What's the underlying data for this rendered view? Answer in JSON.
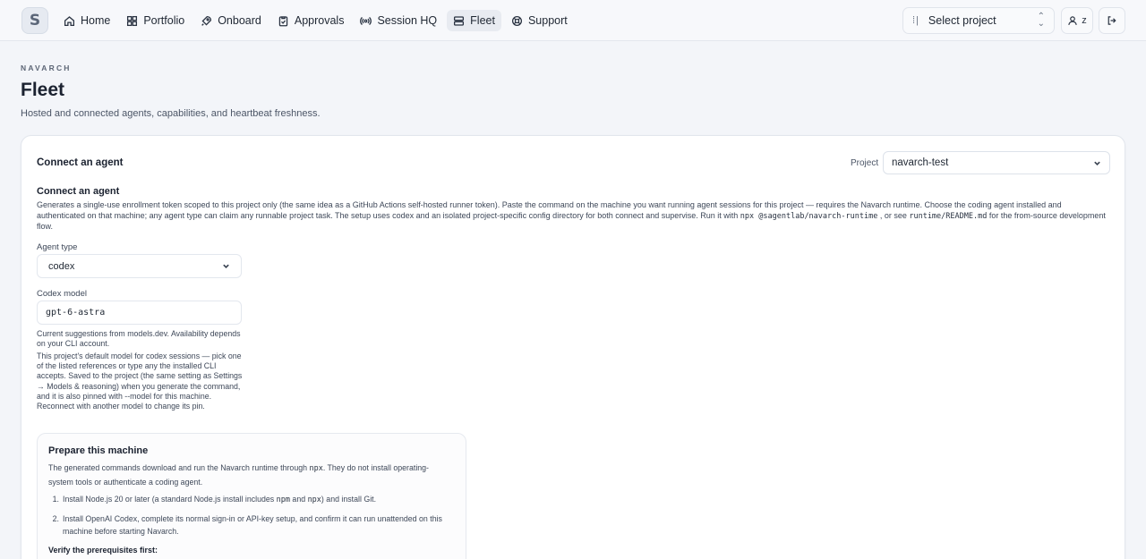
{
  "app": {
    "logo_letter": "S"
  },
  "nav": {
    "items": [
      {
        "label": "Home",
        "icon": "home-icon"
      },
      {
        "label": "Portfolio",
        "icon": "grid-icon"
      },
      {
        "label": "Onboard",
        "icon": "rocket-icon"
      },
      {
        "label": "Approvals",
        "icon": "clipboard-check-icon"
      },
      {
        "label": "Session HQ",
        "icon": "broadcast-icon"
      },
      {
        "label": "Fleet",
        "icon": "server-icon",
        "active": true
      },
      {
        "label": "Support",
        "icon": "lifebuoy-icon"
      }
    ],
    "project_selector": "Select project",
    "user_initial": "z"
  },
  "header": {
    "eyebrow": "NAVARCH",
    "title": "Fleet",
    "subtitle": "Hosted and connected agents, capabilities, and heartbeat freshness."
  },
  "card": {
    "title": "Connect an agent",
    "project_label": "Project",
    "project_value": "navarch-test"
  },
  "connect": {
    "title": "Connect an agent",
    "desc_part1": "Generates a single-use enrollment token scoped to this project only (the same idea as a GitHub Actions self-hosted runner token). Paste the command on the machine you want running agent sessions for this project — requires the Navarch runtime. Choose the coding agent installed and authenticated on that machine; any agent type can claim any runnable project task. The setup uses codex and an isolated project-specific config directory for both connect and supervise. Run it with ",
    "desc_code1": "npx @sagentlab/navarch-runtime",
    "desc_part2": " , or see ",
    "desc_code2": "runtime/README.md",
    "desc_part3": " for the from-source development flow.",
    "agent_type_label": "Agent type",
    "agent_type_value": "codex",
    "model_label": "Codex model",
    "model_value": "gpt-6-astra",
    "help1": "Current suggestions from models.dev. Availability depends on your CLI account.",
    "help2": "This project's default model for codex sessions — pick one of the listed references or type any the installed CLI accepts. Saved to the project (the same setting as Settings → Models & reasoning) when you generate the command, and it is also pinned with --model for this machine. Reconnect with another model to change its pin."
  },
  "prepare": {
    "title": "Prepare this machine",
    "desc_part1": "The generated commands download and run the Navarch runtime through ",
    "desc_code": "npx",
    "desc_part2": ". They do not install operating-system tools or authenticate a coding agent.",
    "step1_num": "1.",
    "step1_part1": "Install Node.js 20 or later (a standard Node.js install includes ",
    "step1_code1": "npm",
    "step1_part2": " and ",
    "step1_code2": "npx",
    "step1_part3": ") and install Git.",
    "step2_num": "2.",
    "step2": "Install OpenAI Codex, complete its normal sign-in or API-key setup, and confirm it can run unattended on this machine before starting Navarch.",
    "verify": "Verify the prerequisites first:"
  }
}
